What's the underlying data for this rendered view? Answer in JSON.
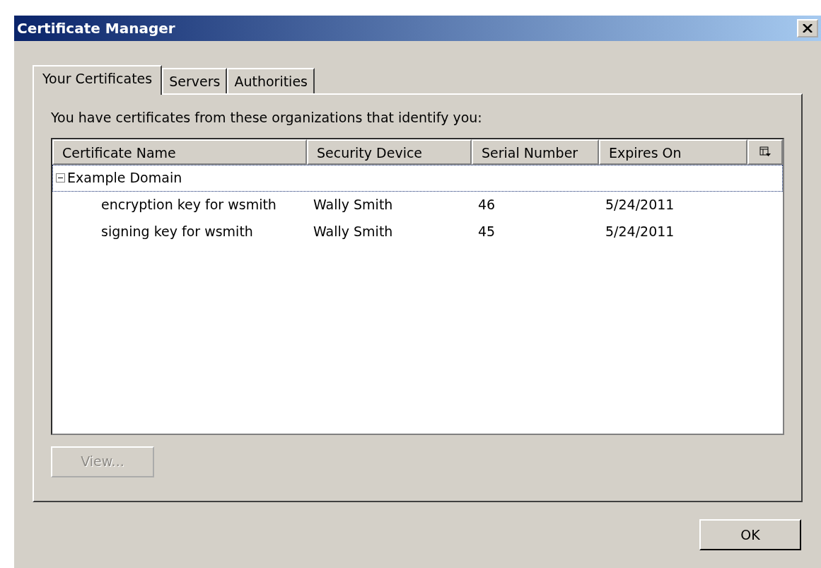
{
  "window": {
    "title": "Certificate Manager"
  },
  "tabs": [
    {
      "label": "Your Certificates",
      "selected": true
    },
    {
      "label": "Servers",
      "selected": false
    },
    {
      "label": "Authorities",
      "selected": false
    }
  ],
  "description": "You have certificates from these organizations that identify you:",
  "table": {
    "columns": [
      "Certificate Name",
      "Security Device",
      "Serial Number",
      "Expires On"
    ],
    "rows": [
      {
        "cells": [
          "Example Domain"
        ],
        "expanded": true,
        "selected": true,
        "children": [
          {
            "cells": [
              "encryption key for wsmith",
              "Wally Smith",
              "46",
              "5/24/2011"
            ],
            "selected": false
          },
          {
            "cells": [
              "signing key for wsmith",
              "Wally Smith",
              "45",
              "5/24/2011"
            ],
            "selected": false
          }
        ]
      }
    ]
  },
  "view_button": {
    "label": "View...",
    "disabled": true
  },
  "ok_button": {
    "label": "OK"
  }
}
